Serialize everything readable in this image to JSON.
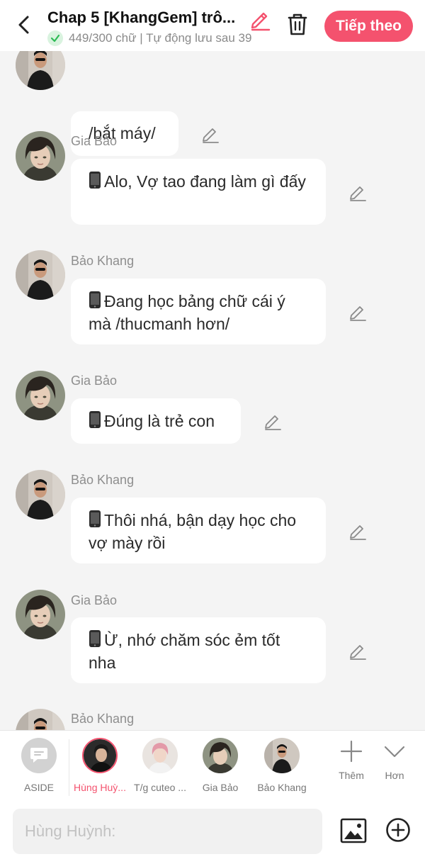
{
  "header": {
    "title": "Chap 5 [KhangGem] trô...",
    "status": "449/300 chữ | Tự động lưu sau 39",
    "next_label": "Tiếp theo",
    "accent_color": "#f4526e"
  },
  "messages": [
    {
      "speaker": "Bảo Khang",
      "text": "/bắt máy/"
    },
    {
      "speaker": "Gia Bảo",
      "text": "Alo, Vợ tao đang làm gì đấy"
    },
    {
      "speaker": "Bảo Khang",
      "text": "Đang học bảng chữ cái ý mà /thucmanh hơn/"
    },
    {
      "speaker": "Gia Bảo",
      "text": "Đúng là trẻ con"
    },
    {
      "speaker": "Bảo Khang",
      "text": "Thôi nhá, bận dạy học cho vợ mày rồi"
    },
    {
      "speaker": "Gia Bảo",
      "text": "Ừ, nhớ chăm sóc ẻm tốt nha"
    },
    {
      "speaker": "Bảo Khang",
      "text": ""
    }
  ],
  "characters": [
    {
      "label": "ASIDE",
      "icon": "message-icon"
    },
    {
      "label": "Hùng Huỳ...",
      "active": true
    },
    {
      "label": "T/g cuteo ..."
    },
    {
      "label": "Gia Bảo"
    },
    {
      "label": "Bảo Khang"
    }
  ],
  "actions": {
    "add_label": "Thêm",
    "more_label": "Hơn"
  },
  "input": {
    "placeholder": "Hùng Huỳnh:"
  }
}
